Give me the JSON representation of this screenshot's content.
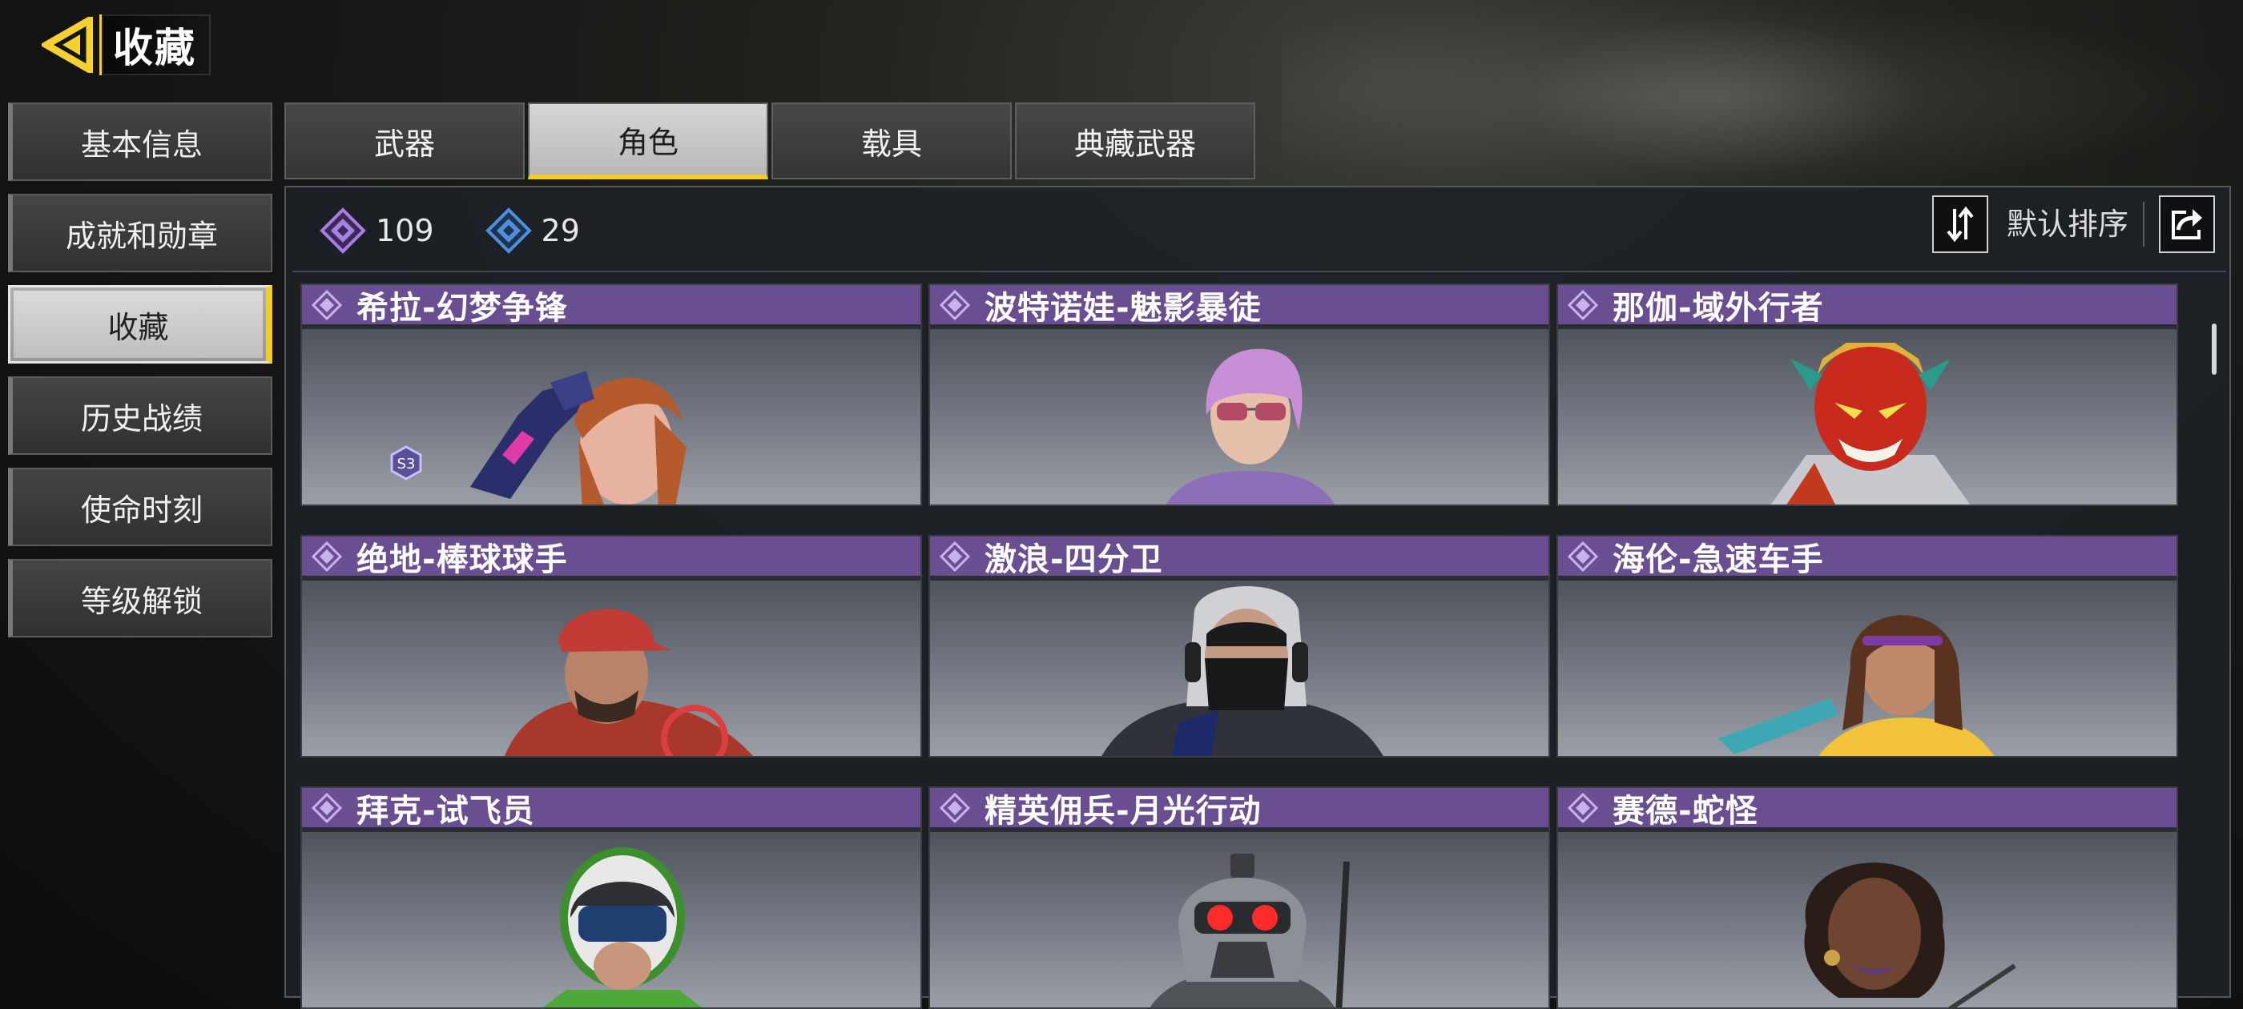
{
  "header": {
    "title": "收藏"
  },
  "sidebar": {
    "items": [
      {
        "label": "基本信息"
      },
      {
        "label": "成就和勋章"
      },
      {
        "label": "收藏",
        "active": true
      },
      {
        "label": "历史战绩"
      },
      {
        "label": "使命时刻"
      },
      {
        "label": "等级解锁"
      }
    ]
  },
  "tabs": [
    {
      "label": "武器"
    },
    {
      "label": "角色",
      "active": true
    },
    {
      "label": "载具"
    },
    {
      "label": "典藏武器"
    }
  ],
  "stats": {
    "epic_count": "109",
    "rare_count": "29"
  },
  "toolbar": {
    "sort_label": "默认排序"
  },
  "colors": {
    "accent": "#f3cc2a",
    "card_header": "#6a4e92",
    "epic": "#a77fe6",
    "rare": "#4f8fde"
  },
  "cards": [
    {
      "name": "希拉-幻梦争锋"
    },
    {
      "name": "波特诺娃-魅影暴徒"
    },
    {
      "name": "那伽-域外行者"
    },
    {
      "name": "绝地-棒球球手"
    },
    {
      "name": "激浪-四分卫"
    },
    {
      "name": "海伦-急速车手"
    },
    {
      "name": "拜克-试飞员"
    },
    {
      "name": "精英佣兵-月光行动"
    },
    {
      "name": "赛德-蛇怪"
    }
  ]
}
